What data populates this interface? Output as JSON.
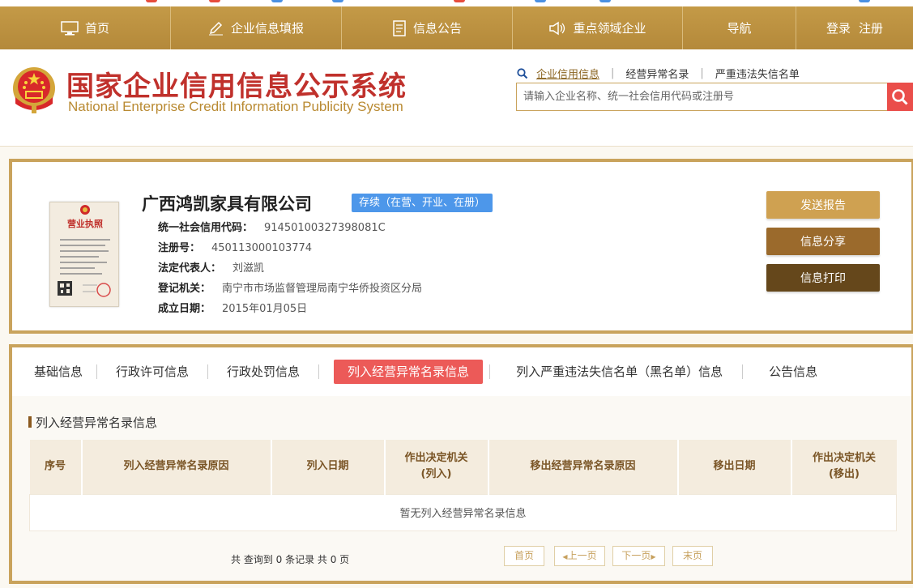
{
  "nav": {
    "items": [
      {
        "label": "首页",
        "icon": "monitor-icon"
      },
      {
        "label": "企业信息填报",
        "icon": "pen-icon"
      },
      {
        "label": "信息公告",
        "icon": "document-icon"
      },
      {
        "label": "重点领域企业",
        "icon": "speaker-icon"
      },
      {
        "label": "导航",
        "icon": ""
      }
    ],
    "login": "登录",
    "register": "注册"
  },
  "header": {
    "title": "国家企业信用信息公示系统",
    "subtitle": "National Enterprise Credit Information Publicity System"
  },
  "search": {
    "tabs": [
      "企业信用信息",
      "经营异常名录",
      "严重违法失信名单"
    ],
    "placeholder": "请输入企业名称、统一社会信用代码或注册号"
  },
  "company": {
    "name": "广西鸿凯家具有限公司",
    "status": "存续（在营、开业、在册）",
    "fields": [
      {
        "label": "统一社会信用代码：",
        "value": "91450100327398081C"
      },
      {
        "label": "注册号：",
        "value": "450113000103774"
      },
      {
        "label": "法定代表人：",
        "value": "刘滋凯"
      },
      {
        "label": "登记机关：",
        "value": "南宁市市场监督管理局南宁华侨投资区分局"
      },
      {
        "label": "成立日期：",
        "value": "2015年01月05日"
      }
    ],
    "license_title": "营业执照"
  },
  "actions": {
    "send_report": "发送报告",
    "share": "信息分享",
    "print": "信息打印"
  },
  "tabs": [
    {
      "label": "基础信息",
      "active": false
    },
    {
      "label": "行政许可信息",
      "active": false
    },
    {
      "label": "行政处罚信息",
      "active": false
    },
    {
      "label": "列入经营异常名录信息",
      "active": true
    },
    {
      "label": "列入严重违法失信名单（黑名单）信息",
      "active": false
    },
    {
      "label": "公告信息",
      "active": false
    }
  ],
  "section": {
    "title": "列入经营异常名录信息",
    "columns": [
      "序号",
      "列入经营异常名录原因",
      "列入日期",
      "作出决定机关\n(列入)",
      "移出经营异常名录原因",
      "移出日期",
      "作出决定机关\n(移出)"
    ],
    "empty_text": "暂无列入经营异常名录信息"
  },
  "pager": {
    "summary": "共 查询到 0 条记录 共 0 页",
    "first": "首页",
    "prev": "上一页",
    "next": "下一页",
    "last": "末页"
  },
  "colors": {
    "gold": "#c49a47",
    "red": "#c0312c",
    "badge_blue": "#4d97ea",
    "active_tab": "#ec5a58",
    "btn_send": "#cfa151",
    "btn_share": "#9b6a2c",
    "btn_print": "#65471b"
  }
}
